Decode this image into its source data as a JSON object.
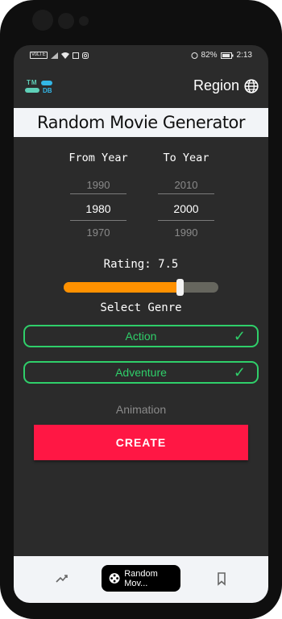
{
  "status_bar": {
    "left_chip": "VoLTE",
    "battery": "82%",
    "time": "2:13"
  },
  "app_bar": {
    "logo_top": "TM",
    "logo_bottom": "DB",
    "region_label": "Region",
    "region_icon": "globe-icon"
  },
  "title": "Random Movie Generator",
  "year_picker": {
    "from_label": "From Year",
    "to_label": "To Year",
    "from": {
      "prev": "1990",
      "current": "1980",
      "next": "1970"
    },
    "to": {
      "prev": "2010",
      "current": "2000",
      "next": "1990"
    }
  },
  "rating": {
    "label": "Rating: 7.5",
    "value_fraction": 0.75
  },
  "genre": {
    "label": "Select Genre",
    "selected": [
      "Action",
      "Adventure"
    ],
    "unselected": [
      "Animation"
    ]
  },
  "create_button": "CREATE",
  "bottom_nav": {
    "active_label": "Random Mov...",
    "items": [
      "trending-icon",
      "movie-reel-icon",
      "bookmark-icon"
    ]
  },
  "colors": {
    "accent_orange": "#ff9100",
    "accent_green": "#2fcf6a",
    "create_red": "#ff1744",
    "background": "#2b2b2b"
  }
}
